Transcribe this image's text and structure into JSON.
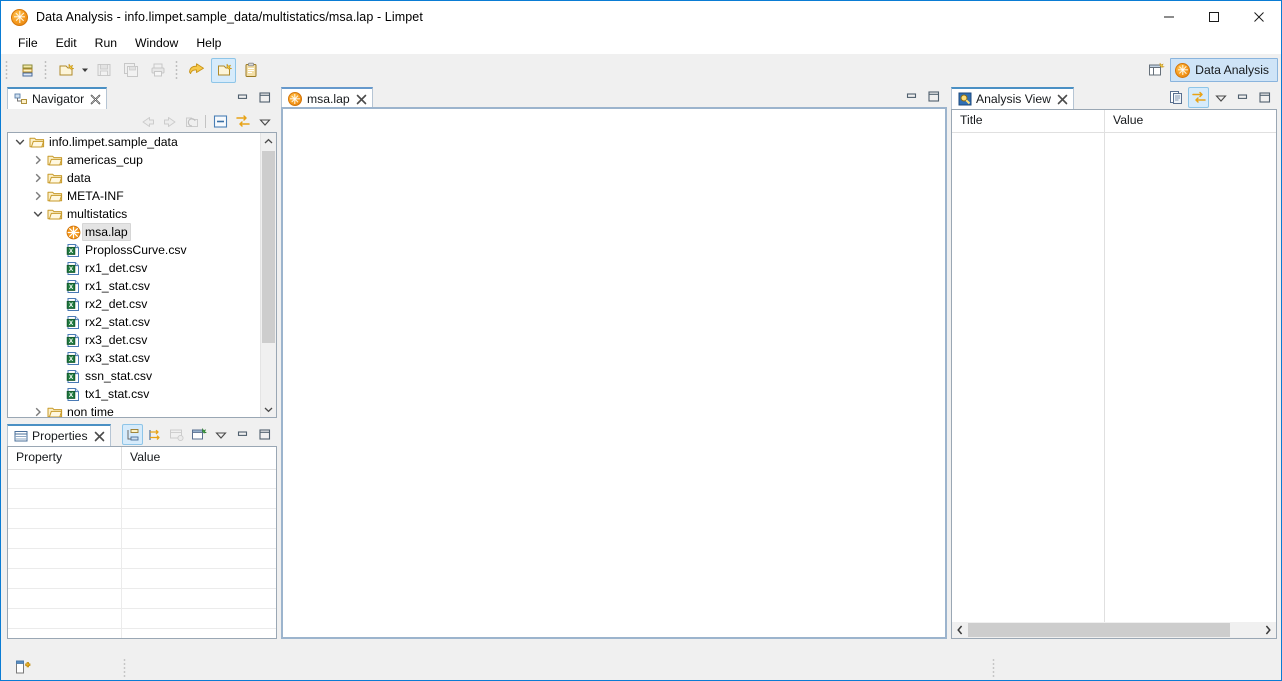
{
  "window": {
    "title": "Data Analysis - info.limpet.sample_data/multistatics/msa.lap - Limpet",
    "app_icon": "limpet-icon",
    "controls": {
      "minimize": "minimize-button",
      "maximize": "maximize-button",
      "close": "close-button"
    }
  },
  "menubar": {
    "items": [
      {
        "label": "File"
      },
      {
        "label": "Edit"
      },
      {
        "label": "Run"
      },
      {
        "label": "Window"
      },
      {
        "label": "Help"
      }
    ]
  },
  "toolbar": {
    "buttons": [
      {
        "name": "list-view-icon",
        "enabled": true
      },
      {
        "name": "new-wizard-icon",
        "enabled": true
      },
      {
        "name": "new-dropdown-arrow",
        "enabled": true
      },
      {
        "name": "save-icon",
        "enabled": false
      },
      {
        "name": "save-all-icon",
        "enabled": false
      },
      {
        "name": "print-icon",
        "enabled": false
      },
      {
        "name": "run-icon",
        "enabled": true
      },
      {
        "name": "new-document-icon",
        "enabled": true
      },
      {
        "name": "paste-clipboard-icon",
        "enabled": true
      }
    ],
    "perspective": {
      "open_perspective_icon": "open-perspective-icon",
      "active_label": "Data Analysis",
      "active_icon": "limpet-icon"
    }
  },
  "navigator": {
    "tab_label": "Navigator",
    "tab_icon": "navigator-icon",
    "close_icon": "close-icon",
    "tools": [
      {
        "name": "back-icon",
        "enabled": false
      },
      {
        "name": "forward-icon",
        "enabled": false
      },
      {
        "name": "home-icon",
        "enabled": false
      },
      {
        "name": "collapse-all-icon",
        "enabled": true
      },
      {
        "name": "link-with-editor-icon",
        "enabled": true
      },
      {
        "name": "view-menu-icon",
        "enabled": true
      }
    ],
    "part_controls": [
      {
        "name": "minimize-icon"
      },
      {
        "name": "maximize-icon"
      }
    ],
    "tree": [
      {
        "label": "info.limpet.sample_data",
        "depth": 0,
        "twisty": "expanded",
        "icon": "project-folder-icon",
        "selected": false
      },
      {
        "label": "americas_cup",
        "depth": 1,
        "twisty": "collapsed",
        "icon": "folder-icon",
        "selected": false
      },
      {
        "label": "data",
        "depth": 1,
        "twisty": "collapsed",
        "icon": "folder-icon",
        "selected": false
      },
      {
        "label": "META-INF",
        "depth": 1,
        "twisty": "collapsed",
        "icon": "folder-icon",
        "selected": false
      },
      {
        "label": "multistatics",
        "depth": 1,
        "twisty": "expanded",
        "icon": "folder-icon",
        "selected": false
      },
      {
        "label": "msa.lap",
        "depth": 2,
        "twisty": "none",
        "icon": "limpet-file-icon",
        "selected": true
      },
      {
        "label": "ProplossCurve.csv",
        "depth": 2,
        "twisty": "none",
        "icon": "csv-file-icon",
        "selected": false
      },
      {
        "label": "rx1_det.csv",
        "depth": 2,
        "twisty": "none",
        "icon": "csv-file-icon",
        "selected": false
      },
      {
        "label": "rx1_stat.csv",
        "depth": 2,
        "twisty": "none",
        "icon": "csv-file-icon",
        "selected": false
      },
      {
        "label": "rx2_det.csv",
        "depth": 2,
        "twisty": "none",
        "icon": "csv-file-icon",
        "selected": false
      },
      {
        "label": "rx2_stat.csv",
        "depth": 2,
        "twisty": "none",
        "icon": "csv-file-icon",
        "selected": false
      },
      {
        "label": "rx3_det.csv",
        "depth": 2,
        "twisty": "none",
        "icon": "csv-file-icon",
        "selected": false
      },
      {
        "label": "rx3_stat.csv",
        "depth": 2,
        "twisty": "none",
        "icon": "csv-file-icon",
        "selected": false
      },
      {
        "label": "ssn_stat.csv",
        "depth": 2,
        "twisty": "none",
        "icon": "csv-file-icon",
        "selected": false
      },
      {
        "label": "tx1_stat.csv",
        "depth": 2,
        "twisty": "none",
        "icon": "csv-file-icon",
        "selected": false
      },
      {
        "label": "non time",
        "depth": 1,
        "twisty": "collapsed",
        "icon": "folder-icon",
        "selected": false
      }
    ]
  },
  "properties": {
    "tab_label": "Properties",
    "tab_icon": "properties-icon",
    "close_icon": "close-icon",
    "tools": [
      {
        "name": "show-categories-icon",
        "enabled": true,
        "active": true
      },
      {
        "name": "show-advanced-icon",
        "enabled": true,
        "active": false
      },
      {
        "name": "restore-default-icon",
        "enabled": false,
        "active": false
      },
      {
        "name": "pin-to-selection-icon",
        "enabled": true,
        "active": false
      },
      {
        "name": "view-menu-icon",
        "enabled": true,
        "active": false
      },
      {
        "name": "minimize-icon",
        "enabled": true,
        "active": false
      },
      {
        "name": "maximize-icon",
        "enabled": true,
        "active": false
      }
    ],
    "columns": [
      {
        "label": "Property"
      },
      {
        "label": "Value"
      }
    ],
    "rows": []
  },
  "editor": {
    "tab_label": "msa.lap",
    "tab_icon": "limpet-file-icon",
    "close_icon": "close-icon",
    "controls": [
      {
        "name": "minimize-icon"
      },
      {
        "name": "maximize-icon"
      }
    ],
    "content": ""
  },
  "analysis_view": {
    "tab_label": "Analysis View",
    "tab_icon": "analysis-view-icon",
    "close_icon": "close-icon",
    "tools": [
      {
        "name": "copy-to-clipboard-icon",
        "enabled": true,
        "active": false
      },
      {
        "name": "link-with-editor-icon",
        "enabled": true,
        "active": true
      },
      {
        "name": "view-menu-icon",
        "enabled": true,
        "active": false
      },
      {
        "name": "minimize-icon",
        "enabled": true,
        "active": false
      },
      {
        "name": "maximize-icon",
        "enabled": true,
        "active": false
      }
    ],
    "columns": [
      {
        "label": "Title"
      },
      {
        "label": "Value"
      }
    ],
    "rows": [],
    "scroll": {
      "left_arrow": "scroll-left-icon",
      "right_arrow": "scroll-right-icon"
    }
  },
  "statusbar": {
    "icon": "workspace-status-icon",
    "text": ""
  }
}
